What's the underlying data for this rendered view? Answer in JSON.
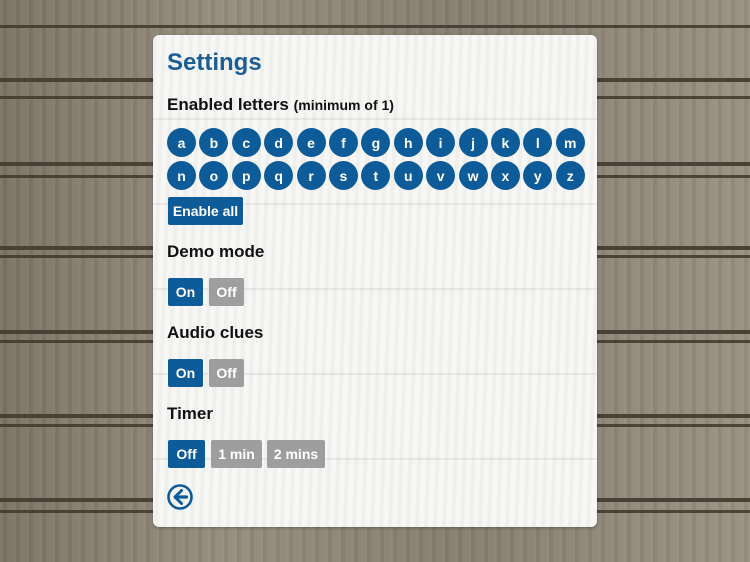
{
  "settings": {
    "title": "Settings",
    "enabled_letters": {
      "heading": "Enabled letters",
      "note": "(minimum of 1)",
      "row1": [
        "a",
        "b",
        "c",
        "d",
        "e",
        "f",
        "g",
        "h",
        "i",
        "j",
        "k",
        "l",
        "m"
      ],
      "row2": [
        "n",
        "o",
        "p",
        "q",
        "r",
        "s",
        "t",
        "u",
        "v",
        "w",
        "x",
        "y",
        "z"
      ],
      "enable_all_label": "Enable all"
    },
    "demo_mode": {
      "heading": "Demo mode",
      "on_label": "On",
      "off_label": "Off",
      "selected": "On"
    },
    "audio_clues": {
      "heading": "Audio clues",
      "on_label": "On",
      "off_label": "Off",
      "selected": "On"
    },
    "timer": {
      "heading": "Timer",
      "options": [
        "Off",
        "1 min",
        "2 mins"
      ],
      "selected": "Off"
    },
    "back_icon": "arrow-left-circle-icon"
  },
  "colors": {
    "accent": "#0d5c99",
    "title": "#1b5e95",
    "inactive": "#9e9e9e"
  }
}
